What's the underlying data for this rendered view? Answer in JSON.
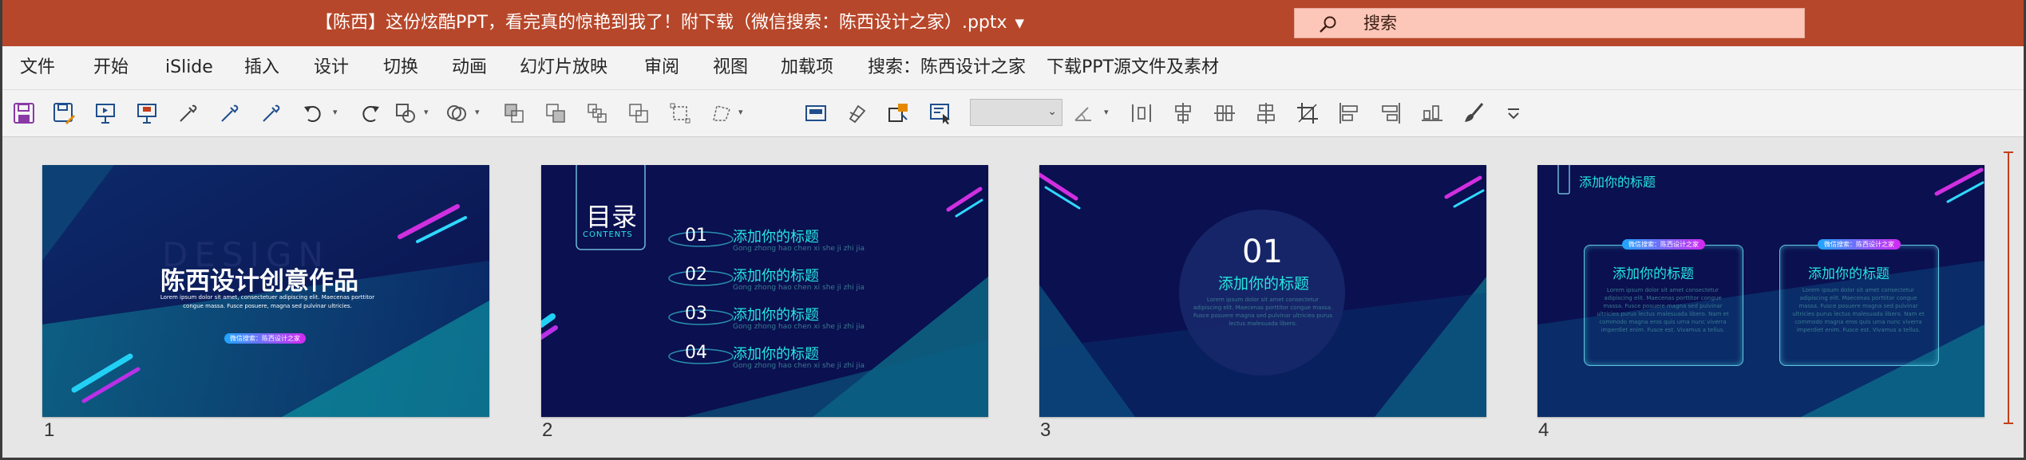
{
  "window": {
    "title": "【陈西】这份炫酷PPT，看完真的惊艳到我了！附下载（微信搜索：陈西设计之家）.pptx",
    "search_placeholder": "搜索"
  },
  "menu": [
    "文件",
    "开始",
    "iSlide",
    "插入",
    "设计",
    "切换",
    "动画",
    "幻灯片放映",
    "审阅",
    "视图",
    "加载项",
    "搜索：陈西设计之家",
    "下载PPT源文件及素材"
  ],
  "toolbar_icons": [
    "save-icon",
    "save-as-icon",
    "slideshow-from-start-icon",
    "slideshow-current-icon",
    "eyedropper-icon",
    "eyedropper-fill-icon",
    "eyedropper-line-icon",
    "undo-icon",
    "redo-icon",
    "shape-fill-icon",
    "shape-outline-icon",
    "bring-forward-icon",
    "send-backward-icon",
    "group-icon",
    "ungroup-icon",
    "selection-icon",
    "edit-points-icon",
    "slide-layout-icon",
    "format-painter-icon",
    "replace-picture-icon",
    "text-box-icon",
    "font-size-combo",
    "rotate-icon",
    "distribute-horizontal-icon",
    "align-center-icon",
    "distribute-vertical-icon",
    "align-middle-icon",
    "crop-icon",
    "align-left-icon",
    "align-right-icon",
    "align-bottom-icon",
    "brush-icon",
    "customize-toolbar-icon"
  ],
  "slides": [
    {
      "number": "1",
      "watermark": "DESIGN",
      "title": "陈西设计创意作品",
      "body": "Lorem ipsum dolor sit amet, consectetuer adipiscing elit. Maecenas porttitor congue massa. Fusce posuere, magna sed pulvinar ultricies.",
      "badge": "微信搜索：陈西设计之家"
    },
    {
      "number": "2",
      "heading": "目录",
      "heading_sub": "CONTENTS",
      "items": [
        {
          "num": "01",
          "label": "添加你的标题",
          "sub": "Gong zhong hao chen xi she ji zhi jia"
        },
        {
          "num": "02",
          "label": "添加你的标题",
          "sub": "Gong zhong hao chen xi she ji zhi jia"
        },
        {
          "num": "03",
          "label": "添加你的标题",
          "sub": "Gong zhong hao chen xi she ji zhi jia"
        },
        {
          "num": "04",
          "label": "添加你的标题",
          "sub": "Gong zhong hao chen xi she ji zhi jia"
        }
      ]
    },
    {
      "number": "3",
      "num": "01",
      "title": "添加你的标题",
      "body": "Lorem ipsum dolor sit amet consectetur adipiscing elit. Maecenas porttitor congue massa. Fusce posuere magna sed pulvinar ultricies purus lectus malesuada libero."
    },
    {
      "number": "4",
      "top_title": "添加你的标题",
      "cards": [
        {
          "badge": "微信搜索：陈西设计之家",
          "title": "添加你的标题",
          "body": "Lorem ipsum dolor sit amet consectetur adipiscing elit. Maecenas porttitor congue massa. Fusce posuere magna sed pulvinar ultricies purus lectus malesuada libero. Nam et commodo magna eros quis urna nunc viverra imperdiet enim. Fusce est. Vivamus a tellus."
        },
        {
          "badge": "微信搜索：陈西设计之家",
          "title": "添加你的标题",
          "body": "Lorem ipsum dolor sit amet consectetur adipiscing elit. Maecenas porttitor congue massa. Fusce posuere magna sed pulvinar ultricies purus lectus malesuada libero. Nam et commodo magna eros quis urna nunc viverra imperdiet enim. Fusce est. Vivamus a tellus."
        }
      ]
    }
  ],
  "colors": {
    "titlebar": "#b7472a",
    "accent": "#c43e1c",
    "slide_bg": "#0b1457",
    "neon_cyan": "#26e6e0"
  }
}
